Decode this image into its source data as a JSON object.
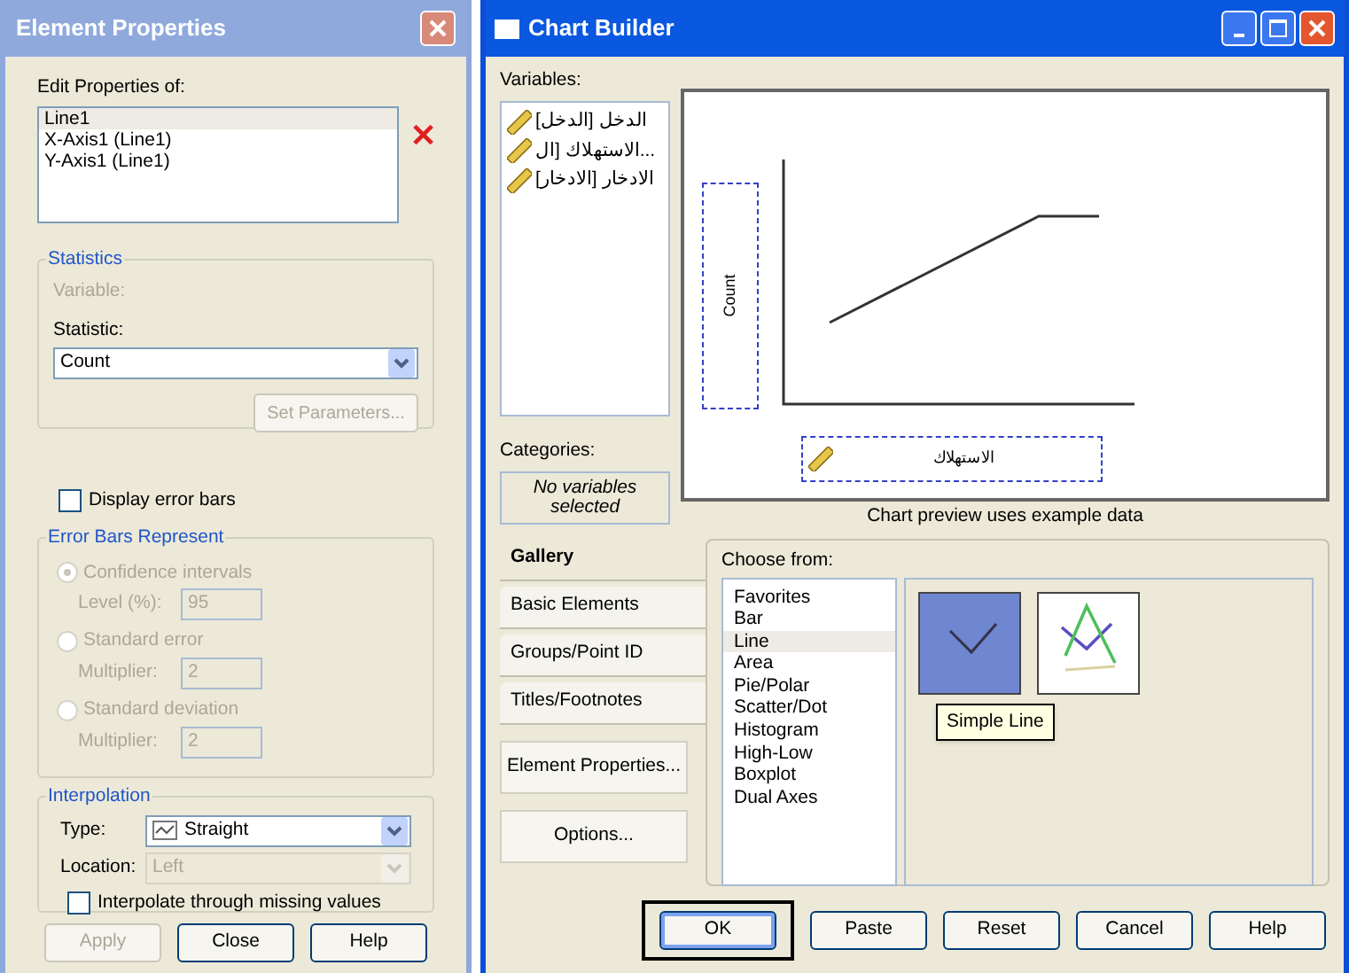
{
  "element_properties": {
    "title": "Element Properties",
    "edit_label": "Edit Properties of:",
    "elements": [
      {
        "label": "Line1",
        "selected": true
      },
      {
        "label": "X-Axis1 (Line1)",
        "selected": false
      },
      {
        "label": "Y-Axis1 (Line1)",
        "selected": false
      }
    ],
    "statistics": {
      "title": "Statistics",
      "variable_label": "Variable:",
      "variable_disabled": true,
      "statistic_label": "Statistic:",
      "statistic": "Count",
      "set_parameters": "Set Parameters...",
      "set_parameters_disabled": true
    },
    "display_error_bars": {
      "label": "Display error bars",
      "checked": false
    },
    "error_bars": {
      "title": "Error Bars Represent",
      "disabled": true,
      "options": [
        {
          "label": "Confidence intervals",
          "selected": true,
          "field_label": "Level (%):",
          "value": "95"
        },
        {
          "label": "Standard error",
          "selected": false,
          "field_label": "Multiplier:",
          "value": "2"
        },
        {
          "label": "Standard deviation",
          "selected": false,
          "field_label": "Multiplier:",
          "value": "2"
        }
      ]
    },
    "interpolation": {
      "title": "Interpolation",
      "type_label": "Type:",
      "type": "Straight",
      "location_label": "Location:",
      "location": "Left",
      "location_disabled": true,
      "missing_label": "Interpolate through missing values",
      "missing_checked": false
    },
    "buttons": [
      {
        "label": "Apply",
        "disabled": true
      },
      {
        "label": "Close",
        "disabled": false
      },
      {
        "label": "Help",
        "disabled": false
      }
    ]
  },
  "chart_builder": {
    "title": "Chart Builder",
    "variables_label": "Variables:",
    "variables": [
      "الدخل [الدخل]",
      "الاستهلاك [ال...",
      "الادخار [الادخار]"
    ],
    "categories_label": "Categories:",
    "categories_empty": "No variables selected",
    "y_axis_label": "Count",
    "x_axis_label": "الاستهلاك",
    "preview_caption": "Chart preview uses example data",
    "side_tabs": [
      {
        "label": "Gallery",
        "selected": true
      },
      {
        "label": "Basic Elements",
        "selected": false
      },
      {
        "label": "Groups/Point ID",
        "selected": false
      },
      {
        "label": "Titles/Footnotes",
        "selected": false
      }
    ],
    "side_buttons": [
      "Element Properties...",
      "Options..."
    ],
    "choose_label": "Choose from:",
    "chart_types": [
      {
        "label": "Favorites",
        "selected": false
      },
      {
        "label": "Bar",
        "selected": false
      },
      {
        "label": "Line",
        "selected": true
      },
      {
        "label": "Area",
        "selected": false
      },
      {
        "label": "Pie/Polar",
        "selected": false
      },
      {
        "label": "Scatter/Dot",
        "selected": false
      },
      {
        "label": "Histogram",
        "selected": false
      },
      {
        "label": "High-Low",
        "selected": false
      },
      {
        "label": "Boxplot",
        "selected": false
      },
      {
        "label": "Dual Axes",
        "selected": false
      }
    ],
    "thumbnails": [
      {
        "kind": "simple",
        "selected": true
      },
      {
        "kind": "multiple",
        "selected": false
      }
    ],
    "tooltip": "Simple Line",
    "buttons": [
      {
        "label": "OK",
        "default": true
      },
      {
        "label": "Paste",
        "default": false
      },
      {
        "label": "Reset",
        "default": false
      },
      {
        "label": "Cancel",
        "default": false
      },
      {
        "label": "Help",
        "default": false
      }
    ]
  }
}
